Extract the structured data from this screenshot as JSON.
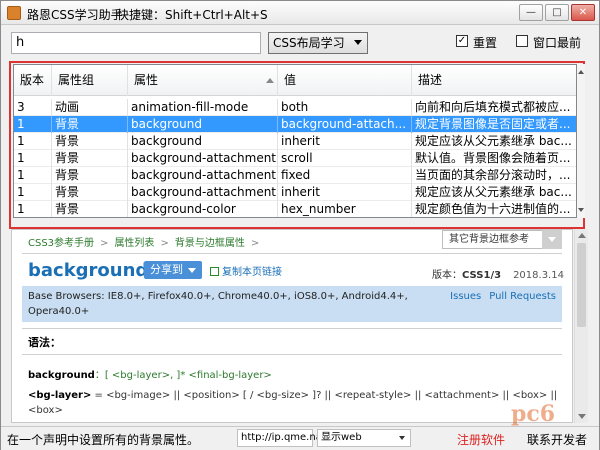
{
  "window": {
    "title": "路恩CSS学习助手",
    "shortcut": "快捷键：Shift+Ctrl+Alt+S",
    "min_label": "—",
    "max_label": "□",
    "close_label": "✕"
  },
  "toolbar": {
    "search_value": "h",
    "category_selected": "CSS布局学习",
    "reset_checked": "✓",
    "reset_label": "重置",
    "topmost_checked": "",
    "topmost_label": "窗口最前"
  },
  "grid": {
    "columns": [
      "版本",
      "属性组",
      "属性",
      "值",
      "描述"
    ],
    "rows": [
      {
        "version": "3",
        "group": "动画",
        "property": "animation-fill-mode",
        "value": "both",
        "desc": "向前和向后填充模式都被应..."
      },
      {
        "version": "1",
        "group": "背景",
        "property": "background",
        "value": "background-attach...",
        "desc": "规定背景图像是否固定或者..."
      },
      {
        "version": "1",
        "group": "背景",
        "property": "background",
        "value": "inherit",
        "desc": "规定应该从父元素继承 bac..."
      },
      {
        "version": "1",
        "group": "背景",
        "property": "background-attachment",
        "value": "scroll",
        "desc": "默认值。背景图像会随着页..."
      },
      {
        "version": "1",
        "group": "背景",
        "property": "background-attachment",
        "value": "fixed",
        "desc": "当页面的其余部分滚动时，..."
      },
      {
        "version": "1",
        "group": "背景",
        "property": "background-attachment",
        "value": "inherit",
        "desc": "规定应该从父元素继承 bac..."
      },
      {
        "version": "1",
        "group": "背景",
        "property": "background-color",
        "value": "hex_number",
        "desc": "规定颜色值为十六进制值的..."
      }
    ],
    "selected_index": 1
  },
  "content": {
    "breadcrumbs": [
      "CSS3参考手册",
      ">",
      "属性列表",
      ">",
      "背景与边框属性",
      ">"
    ],
    "other_ref": "其它背景边框参考",
    "heading": "background",
    "share_label": "分享到",
    "copy_link_label": "复制本页链接",
    "version_label": "版本：",
    "version_value": "CSS1/3",
    "date": "2018.3.14",
    "browsers_line1": "Base Browsers: IE8.0+, Firefox40.0+, Chrome40.0+, iOS8.0+, Android4.4+,",
    "browsers_line2": "Opera40.0+",
    "issues_label": "Issues",
    "pull_label": "Pull Requests",
    "syntax_label": "语法：",
    "syntax1_name": "background",
    "syntax1_rest": "：[ <bg-layer>, ]* <final-bg-layer>",
    "syntax2_name": "<bg-layer>",
    "syntax2_rest": " = <bg-image> || <position> [ / <bg-size> ]? || <repeat-style> || <attachment> || <box> || <box>"
  },
  "statusbar": {
    "left_text": "在一个声明中设置所有的背景属性。",
    "url": "http://ip.qme.na",
    "display_select": "显示web",
    "register_label": "注册软件",
    "contact_label": "联系开发者"
  },
  "watermark": "pc6",
  "colors": {
    "selection": "#3399ff",
    "red_frame": "#dd3333",
    "heading_blue": "#1a6fb5",
    "breadcrumb_green": "#2d7a2d"
  }
}
